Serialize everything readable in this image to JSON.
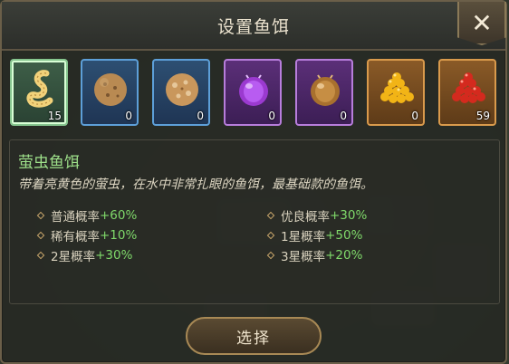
{
  "dialog": {
    "title": "设置鱼饵",
    "close_icon": "close-icon"
  },
  "baits": [
    {
      "name": "worm",
      "rarity": "green",
      "count": "15",
      "selected": true
    },
    {
      "name": "brown-ball",
      "rarity": "blue",
      "count": "0"
    },
    {
      "name": "speckled-ball",
      "rarity": "blue",
      "count": "0"
    },
    {
      "name": "purple-beetle",
      "rarity": "purple",
      "count": "0"
    },
    {
      "name": "bronze-beetle",
      "rarity": "purple",
      "count": "0"
    },
    {
      "name": "golden-pellets",
      "rarity": "orange",
      "count": "0"
    },
    {
      "name": "red-roe",
      "rarity": "orange",
      "count": "59"
    }
  ],
  "detail": {
    "name": "萤虫鱼饵",
    "description": "带着亮黄色的萤虫，在水中非常扎眼的鱼饵，最基础款的鱼饵。",
    "stats_left": [
      {
        "label": "普通概率",
        "value": "+60%"
      },
      {
        "label": "稀有概率",
        "value": "+10%"
      },
      {
        "label": "2星概率",
        "value": "+30%"
      }
    ],
    "stats_right": [
      {
        "label": "优良概率",
        "value": "+30%"
      },
      {
        "label": "1星概率",
        "value": "+50%"
      },
      {
        "label": "3星概率",
        "value": "+20%"
      }
    ]
  },
  "actions": {
    "select_label": "选择"
  },
  "colors": {
    "green": "#86c58f",
    "blue": "#5d9fd8",
    "purple": "#b77ddb",
    "orange": "#d99a4c",
    "accent_value": "#7fd96a"
  }
}
